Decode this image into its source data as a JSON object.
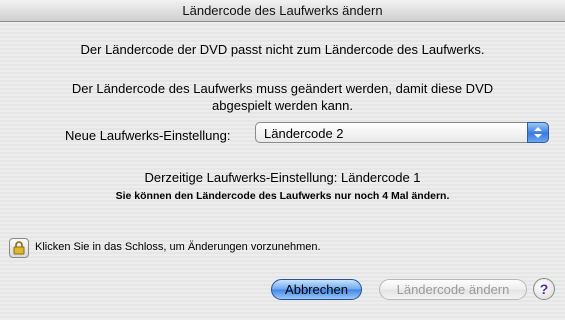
{
  "window": {
    "title": "Ländercode des Laufwerks ändern"
  },
  "message": {
    "line1": "Der Ländercode der DVD passt nicht zum Ländercode des Laufwerks.",
    "line2": "Der Ländercode des Laufwerks muss geändert werden, damit diese DVD",
    "line3": "abgespielt werden kann."
  },
  "setting": {
    "label": "Neue Laufwerks-Einstellung:",
    "selected": "Ländercode 2"
  },
  "status": {
    "current": "Derzeitige Laufwerks-Einstellung: Ländercode 1",
    "remaining": "Sie können den Ländercode des Laufwerks nur noch 4 Mal ändern."
  },
  "lock": {
    "icon": "lock-icon",
    "text": "Klicken Sie in das Schloss, um Änderungen vorzunehmen."
  },
  "buttons": {
    "cancel": "Abbrechen",
    "change": "Ländercode ändern",
    "help": "?"
  }
}
